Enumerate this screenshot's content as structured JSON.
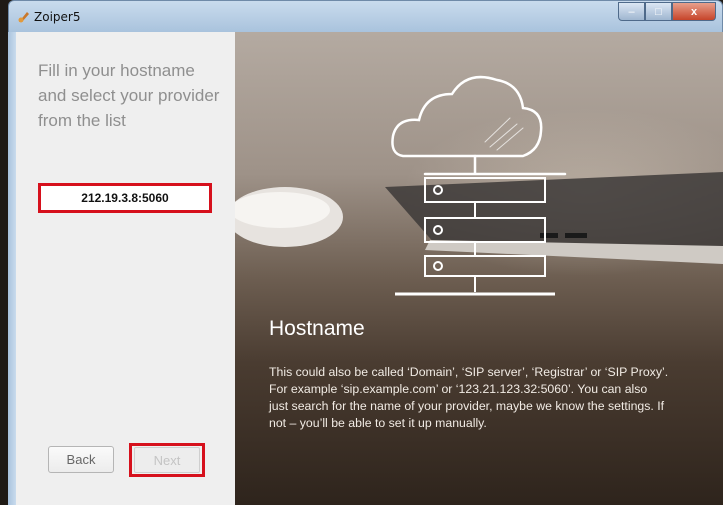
{
  "window": {
    "title": "Zoiper5",
    "controls": {
      "minimize": "–",
      "maximize": "□",
      "close": "x"
    }
  },
  "left_panel": {
    "heading": "Fill in your hostname and select your provider from the list",
    "hostname_value": "212.19.3.8:5060",
    "back_label": "Back",
    "next_label": "Next"
  },
  "right_panel": {
    "title": "Hostname",
    "description": "This could also be called ‘Domain’, ‘SIP server’, ‘Registrar’ or ‘SIP Proxy’. For example ‘sip.example.com’ or ‘123.21.123.32:5060’. You can also just search for the name of your provider, maybe we know the settings. If not – you’ll be able to set it up manually."
  },
  "colors": {
    "highlight": "#d6101c",
    "left_bg": "#efefef",
    "heading_text": "#8f8f8f"
  }
}
